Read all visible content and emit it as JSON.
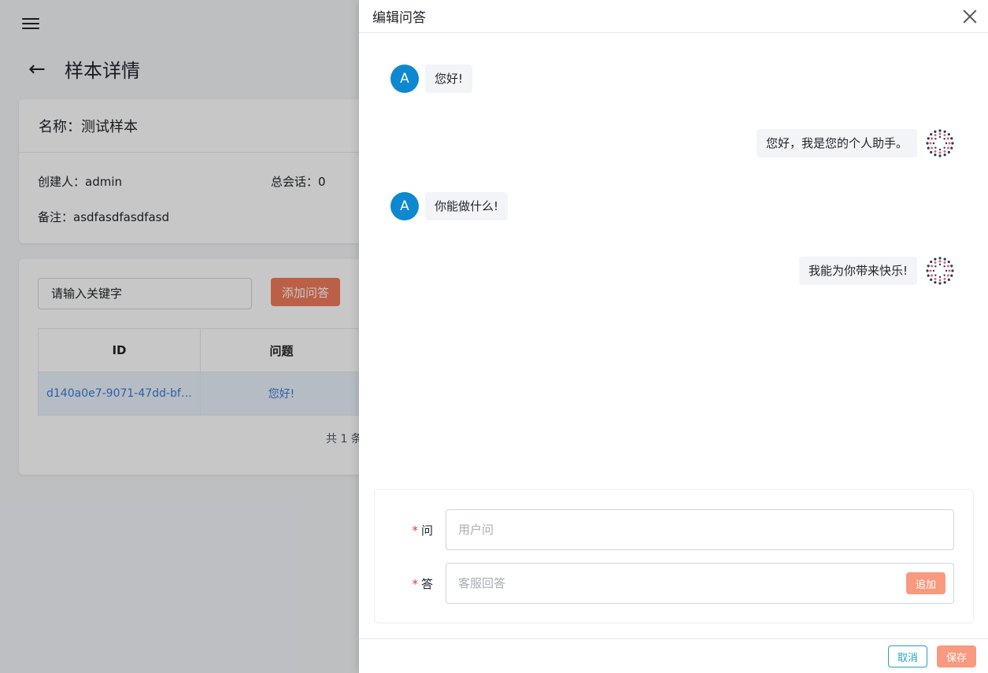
{
  "page": {
    "title": "样本详情",
    "info": {
      "name_label": "名称：",
      "name_value": "测试样本",
      "creator_label": "创建人：",
      "creator_value": "admin",
      "sessions_label": "总会话：",
      "sessions_value": "0",
      "note_label": "备注：",
      "note_value": "asdfasdfasdfasd"
    },
    "search": {
      "placeholder": "请输入关键字",
      "value": "请输入关键字"
    },
    "add_button": "添加问答",
    "table": {
      "headers": [
        "ID",
        "问题"
      ],
      "rows": [
        {
          "id": "d140a0e7-9071-47dd-bf0a...",
          "question": "您好!"
        }
      ]
    },
    "total_text": "共 1 条"
  },
  "drawer": {
    "title": "编辑问答",
    "messages": [
      {
        "role": "user",
        "avatar": "A",
        "text": "您好!"
      },
      {
        "role": "bot",
        "text": "您好，我是您的个人助手。"
      },
      {
        "role": "user",
        "avatar": "A",
        "text": "你能做什么!"
      },
      {
        "role": "bot",
        "text": "我能为你带来快乐!"
      }
    ],
    "form": {
      "question_label": "问",
      "question_placeholder": "用户问",
      "answer_label": "答",
      "answer_placeholder": "客服回答",
      "append_button": "追加",
      "required_mark": "*"
    },
    "footer": {
      "cancel": "取消",
      "save": "保存"
    }
  },
  "colors": {
    "accent": "#f07c5c",
    "user_avatar": "#0e88cf",
    "cancel_border": "#1fa3c9"
  },
  "icons": [
    "menu-icon",
    "back-arrow-icon",
    "close-icon",
    "bot-avatar-icon"
  ]
}
